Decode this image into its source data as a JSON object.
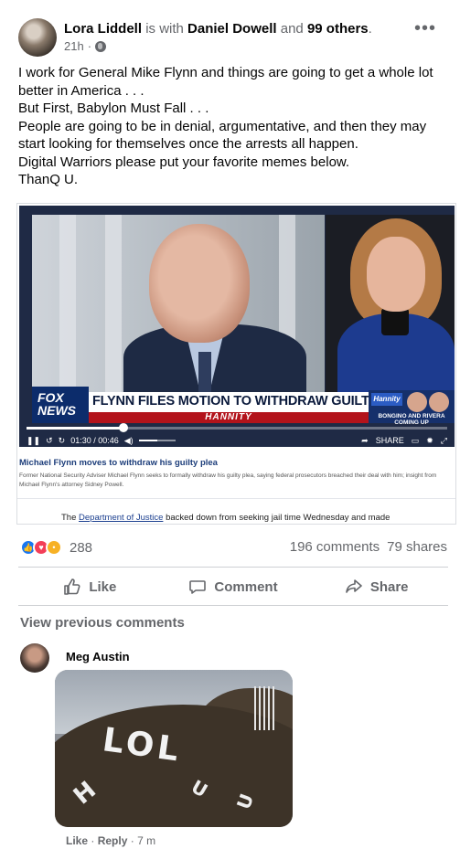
{
  "post": {
    "author": "Lora Liddell",
    "with_text": "is with",
    "tagged": "Daniel Dowell",
    "and_text": "and",
    "others": "99 others",
    "period": ".",
    "time": "21h",
    "audience_icon": "globe-icon",
    "more_icon": "more-options-icon",
    "lines": [
      "I work for General Mike Flynn and things are going to get a whole lot",
      "better in America . . .",
      "But First, Babylon Must Fall . . .",
      "People are going to be in denial, argumentative, and then they may",
      "start looking for themselves once the arrests all happen.",
      "Digital Warriors please put your favorite memes below.",
      "ThanQ U."
    ]
  },
  "video": {
    "network_logo": "FOX NEWS",
    "headline": "FLYNN FILES MOTION TO WITHDRAW GUILTY PLEA",
    "show_name": "HANNITY",
    "badge_logo": "Hannity",
    "badge_text": "BONGINO AND RIVERA COMING UP",
    "time": "01:30 / 00:46",
    "share_label": "SHARE",
    "progress": 0.23,
    "volume": 0.5
  },
  "article": {
    "title": "Michael Flynn moves to withdraw his guilty plea",
    "body": "Former National Security Adviser Michael Flynn seeks to formally withdraw his guilty plea, saying federal prosecutors breached their deal with him; insight from Michael Flynn's attorney Sidney Powell.",
    "foot_prefix": "The",
    "foot_link": "Department of Justice",
    "foot_suffix": "backed down from seeking jail time Wednesday and made"
  },
  "reactions": {
    "count": "288",
    "comments": "196 comments",
    "shares": "79 shares",
    "types": [
      "like",
      "love",
      "wow"
    ]
  },
  "actions": {
    "like": "Like",
    "comment": "Comment",
    "share": "Share"
  },
  "comments": {
    "view_previous": "View previous comments",
    "items": [
      {
        "author": "Meg Austin",
        "image_text": "LOL",
        "like": "Like",
        "reply": "Reply",
        "time": "7 m",
        "separator": "·"
      }
    ]
  },
  "colors": {
    "accent": "#1877f2",
    "muted": "#65676b",
    "love": "#f33e58",
    "wow": "#f7b125"
  }
}
